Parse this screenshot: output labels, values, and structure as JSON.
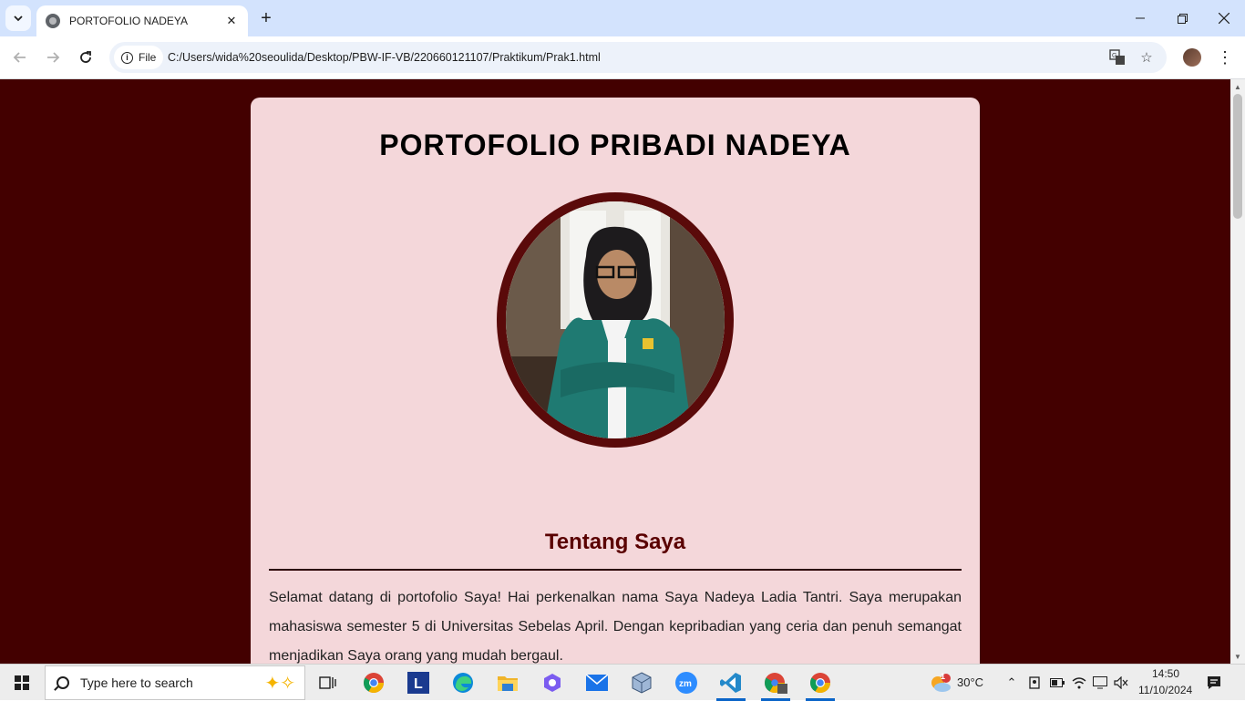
{
  "browser": {
    "tab_title": "PORTOFOLIO NADEYA",
    "chip_label": "File",
    "url": "C:/Users/wida%20seoulida/Desktop/PBW-IF-VB/220660121107/Praktikum/Prak1.html"
  },
  "page": {
    "title": "PORTOFOLIO PRIBADI NADEYA",
    "about_heading": "Tentang Saya",
    "about_text": "Selamat datang di portofolio Saya! Hai perkenalkan nama Saya Nadeya Ladia Tantri. Saya merupakan mahasiswa semester 5 di Universitas Sebelas April. Dengan kepribadian yang ceria dan penuh semangat menjadikan Saya orang yang mudah bergaul."
  },
  "taskbar": {
    "search_placeholder": "Type here to search",
    "weather_temp": "30°C",
    "weather_badge": "1",
    "time": "14:50",
    "date": "11/10/2024"
  },
  "colors": {
    "background": "#430000",
    "card": "#f4d7da",
    "accent": "#5a0a0a"
  }
}
